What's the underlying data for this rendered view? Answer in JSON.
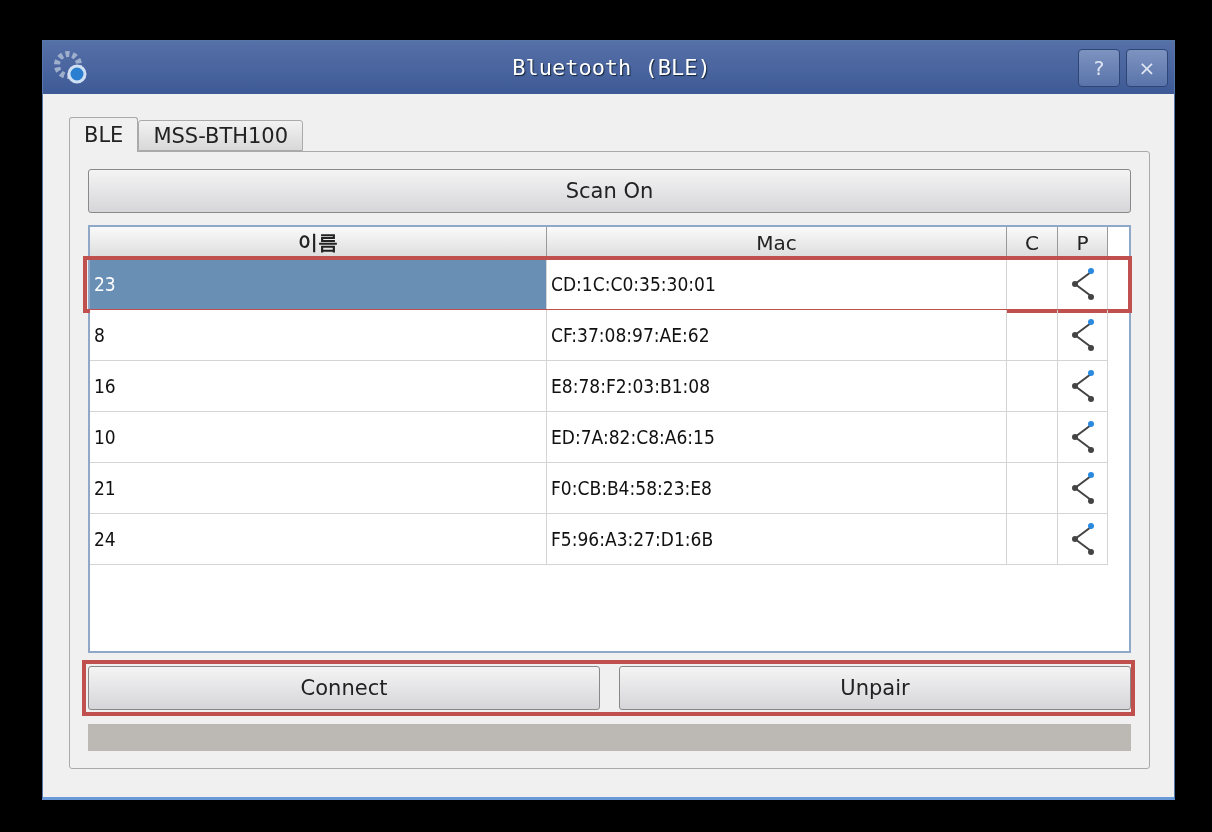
{
  "window": {
    "title": "Bluetooth (BLE)",
    "buttons": [
      "?",
      "×"
    ]
  },
  "tabs": [
    {
      "label": "BLE",
      "selected": true
    },
    {
      "label": "MSS-BTH100",
      "selected": false
    }
  ],
  "scan_button": "Scan On",
  "table": {
    "columns": [
      "이름",
      "Mac",
      "C",
      "P"
    ],
    "rows": [
      {
        "name": "23",
        "mac": "CD:1C:C0:35:30:01",
        "selected": true,
        "highlighted": true
      },
      {
        "name": "8",
        "mac": "CF:37:08:97:AE:62",
        "selected": false,
        "highlighted": false
      },
      {
        "name": "16",
        "mac": "E8:78:F2:03:B1:08",
        "selected": false,
        "highlighted": false
      },
      {
        "name": "10",
        "mac": "ED:7A:82:C8:A6:15",
        "selected": false,
        "highlighted": false
      },
      {
        "name": "21",
        "mac": "F0:CB:B4:58:23:E8",
        "selected": false,
        "highlighted": false
      },
      {
        "name": "24",
        "mac": "F5:96:A3:27:D1:6B",
        "selected": false,
        "highlighted": false
      }
    ]
  },
  "actions": {
    "highlighted": true,
    "buttons": [
      "Connect",
      "Unpair"
    ]
  }
}
